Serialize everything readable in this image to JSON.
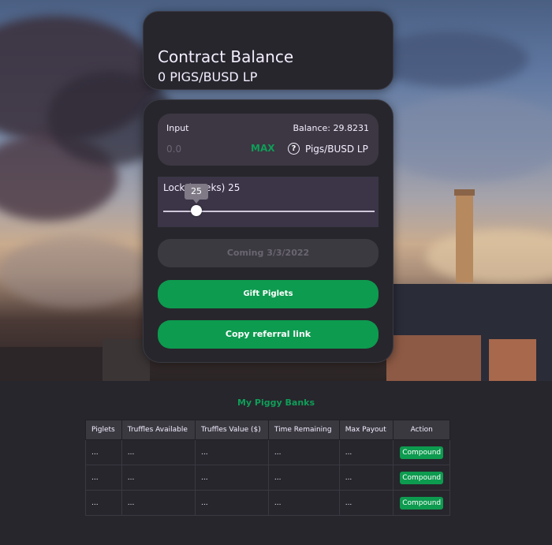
{
  "contract": {
    "title": "Contract Balance",
    "amount": "0 PIGS/BUSD LP"
  },
  "input": {
    "label": "Input",
    "balance": "Balance: 29.8231",
    "value_placeholder": "0.0",
    "max_label": "MAX",
    "token": "Pigs/BUSD LP",
    "help_icon": "question-circle-icon"
  },
  "lock": {
    "label": "Lock (weeks) 25",
    "value": 25,
    "tooltip": "25",
    "fraction": 0.1
  },
  "buttons": {
    "coming": "Coming 3/3/2022",
    "gift": "Gift Piglets",
    "copy": "Copy referral link"
  },
  "table": {
    "title": "My Piggy Banks",
    "headers": [
      "Piglets",
      "Truffles Available",
      "Truffles Value ($)",
      "Time Remaining",
      "Max Payout",
      "Action"
    ],
    "rows": [
      [
        "...",
        "...",
        "...",
        "...",
        "...",
        "Compound"
      ],
      [
        "...",
        "...",
        "...",
        "...",
        "...",
        "Compound"
      ],
      [
        "...",
        "...",
        "...",
        "...",
        "...",
        "Compound"
      ]
    ]
  },
  "colors": {
    "accent": "#0d9b4f",
    "card": "#27262c",
    "input_bg": "#3c3742"
  }
}
